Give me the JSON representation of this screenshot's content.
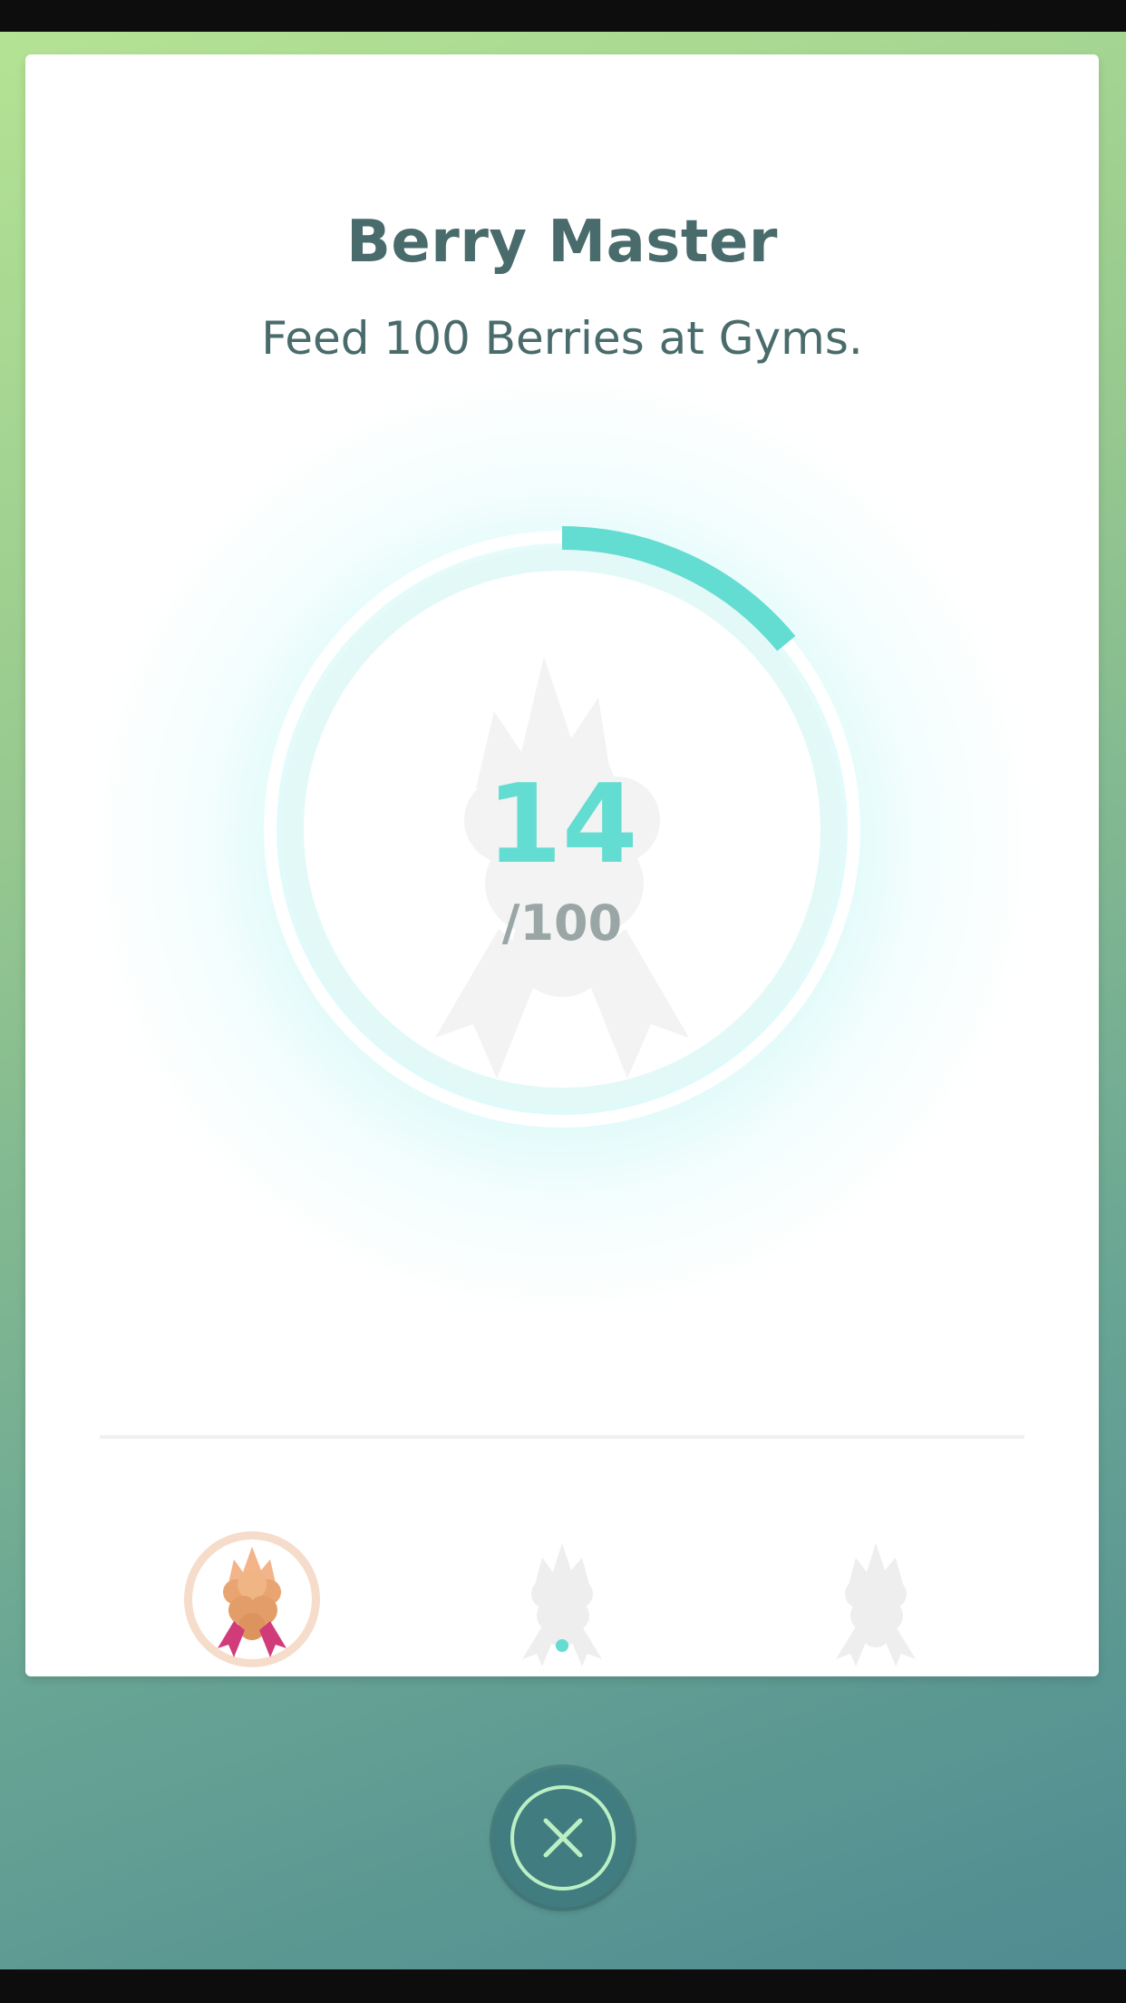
{
  "medal": {
    "title": "Berry Master",
    "description": "Feed 100 Berries at Gyms.",
    "progress_current": "14",
    "progress_total": "/100",
    "progress_fraction": 0.14
  },
  "tiers": [
    {
      "name": "bronze",
      "achieved": true
    },
    {
      "name": "silver",
      "achieved": false
    },
    {
      "name": "gold",
      "achieved": false
    }
  ],
  "pagination": {
    "current_page": 1
  },
  "colors": {
    "accent": "#63dcd1",
    "title": "#4a6b6b",
    "close_button": "#417c80",
    "bronze": "#e8a572"
  },
  "icons": {
    "close": "close-x-icon",
    "medal": "berry-medal-icon"
  }
}
